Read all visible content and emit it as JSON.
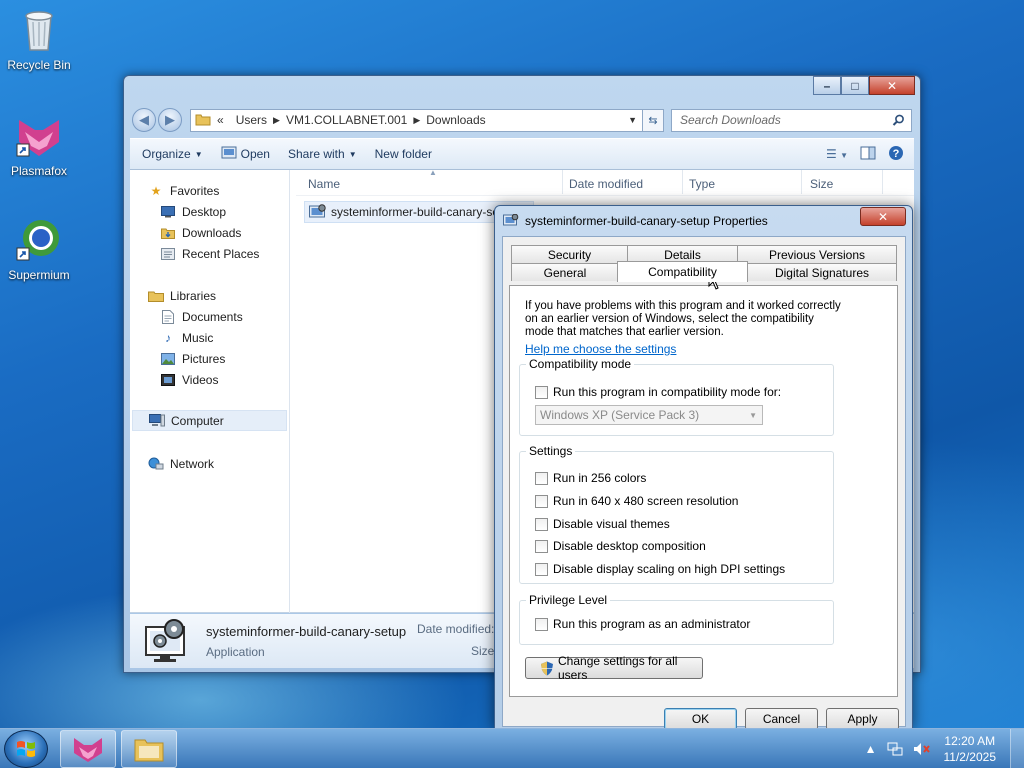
{
  "desktop": {
    "icons": [
      {
        "label": "Recycle Bin"
      },
      {
        "label": "Plasmafox"
      },
      {
        "label": "Supermium"
      }
    ]
  },
  "explorer": {
    "address": {
      "overflow": "«",
      "segments": [
        "Users",
        "VM1.COLLABNET.001",
        "Downloads"
      ]
    },
    "search_placeholder": "Search Downloads",
    "toolbar": {
      "organize": "Organize",
      "open": "Open",
      "share_with": "Share with",
      "new_folder": "New folder"
    },
    "nav": {
      "favorites": "Favorites",
      "desktop": "Desktop",
      "downloads": "Downloads",
      "recent_places": "Recent Places",
      "libraries": "Libraries",
      "documents": "Documents",
      "music": "Music",
      "pictures": "Pictures",
      "videos": "Videos",
      "computer": "Computer",
      "network": "Network"
    },
    "columns": {
      "name": "Name",
      "date_modified": "Date modified",
      "type": "Type",
      "size": "Size"
    },
    "files": [
      {
        "name": "systeminformer-build-canary-setup"
      }
    ],
    "details": {
      "name": "systeminformer-build-canary-setup",
      "type": "Application",
      "date_label": "Date modified:",
      "size_label": "Size:"
    }
  },
  "props": {
    "title": "systeminformer-build-canary-setup Properties",
    "tabs_back": [
      "Security",
      "Details",
      "Previous Versions"
    ],
    "tabs_front": [
      "General",
      "Compatibility",
      "Digital Signatures"
    ],
    "active_tab": "Compatibility",
    "intro": "If you have problems with this program and it worked correctly on an earlier version of Windows, select the compatibility mode that matches that earlier version.",
    "help_link": "Help me choose the settings",
    "compat_mode": {
      "title": "Compatibility mode",
      "checkbox": "Run this program in compatibility mode for:",
      "checked": false,
      "select_value": "Windows XP (Service Pack 3)"
    },
    "settings": {
      "title": "Settings",
      "items": [
        "Run in 256 colors",
        "Run in 640 x 480 screen resolution",
        "Disable visual themes",
        "Disable desktop composition",
        "Disable display scaling on high DPI settings"
      ]
    },
    "privilege": {
      "title": "Privilege Level",
      "checkbox": "Run this program as an administrator"
    },
    "change_all": "Change settings for all users",
    "buttons": {
      "ok": "OK",
      "cancel": "Cancel",
      "apply": "Apply"
    }
  },
  "taskbar": {
    "time": "12:20 AM",
    "date": "11/2/2025"
  }
}
